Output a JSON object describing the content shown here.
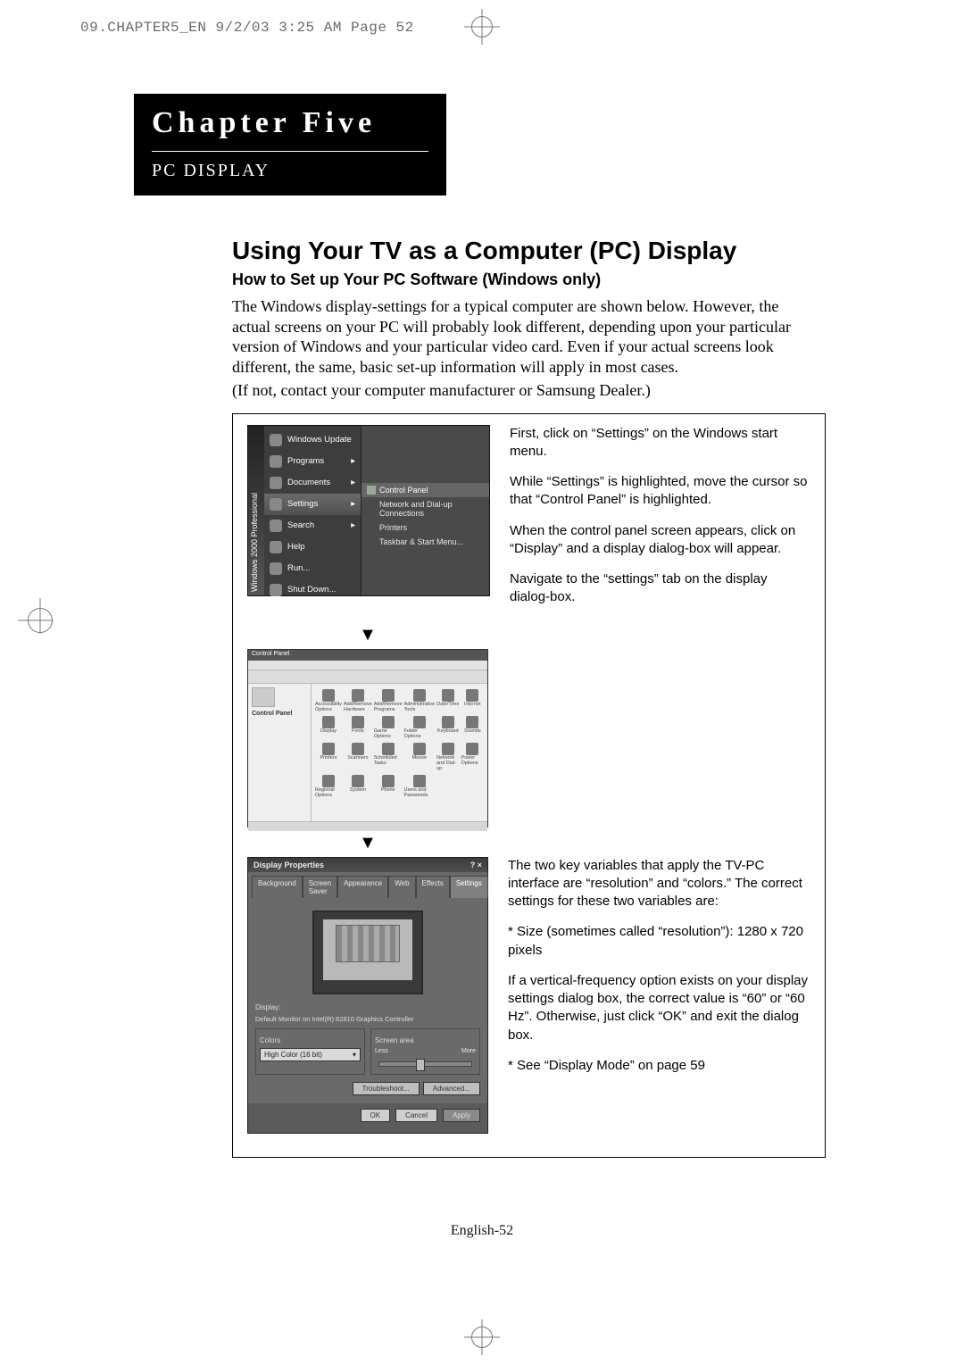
{
  "print_header": "09.CHAPTER5_EN  9/2/03 3:25 AM  Page 52",
  "chapter": {
    "title": "Chapter Five",
    "subtitle": "PC DISPLAY"
  },
  "headings": {
    "main": "Using Your TV as a Computer (PC) Display",
    "sub": "How to Set up Your PC Software (Windows only)"
  },
  "intro": {
    "p1": "The Windows display-settings for a typical computer are shown below. However, the actual screens on your PC will probably look different, depending upon your particular version of Windows and your particular video card. Even if your actual screens look different, the same, basic set-up information will apply in most cases.",
    "p2": "(If not, contact your computer manufacturer or Samsung Dealer.)"
  },
  "startmenu": {
    "sidebar": "Windows 2000 Professional",
    "items": [
      "Windows Update",
      "Programs",
      "Documents",
      "Settings",
      "Search",
      "Help",
      "Run...",
      "Shut Down..."
    ],
    "selected": "Settings",
    "submenu_title": "Control Panel",
    "submenu": [
      "Network and Dial-up Connections",
      "Printers",
      "Taskbar & Start Menu..."
    ]
  },
  "step1": {
    "p1": "First, click on “Settings” on the Windows start menu.",
    "p2": "While “Settings” is highlighted, move the cursor so that “Control Panel” is highlighted.",
    "p3": "When the control panel screen appears, click on “Display” and a display dialog-box will appear.",
    "p4": "Navigate to the “settings” tab on the display dialog-box."
  },
  "controlpanel": {
    "title": "Control Panel",
    "left_title": "Control Panel",
    "icons": [
      "Accessibility Options",
      "Add/Remove Hardware",
      "Add/Remove Programs",
      "Administrative Tools",
      "Date/Time",
      "Internet",
      "Display",
      "Fonts",
      "Game Options",
      "Folder Options",
      "Keyboard",
      "Sounds",
      "Printers",
      "Scanners",
      "Scheduled Tasks",
      "Mouse",
      "Network and Dial-up",
      "Power Options",
      "Regional Options",
      "System",
      "Phone",
      "Users and Passwords"
    ]
  },
  "displayprops": {
    "title": "Display Properties",
    "tabs": [
      "Background",
      "Screen Saver",
      "Appearance",
      "Web",
      "Effects",
      "Settings"
    ],
    "active_tab": "Settings",
    "display_label": "Display:",
    "display_value": "Default Monitor on Intel(R) 82810 Graphics Controller",
    "colors_group": "Colors",
    "colors_value": "High Color (16 bit)",
    "screen_area_group": "Screen area",
    "screen_area_less": "Less",
    "screen_area_more": "More",
    "btn_troubleshoot": "Troubleshoot...",
    "btn_advanced": "Advanced...",
    "btn_ok": "OK",
    "btn_cancel": "Cancel",
    "btn_apply": "Apply"
  },
  "step2": {
    "p1": "The two key variables that apply the TV-PC interface are “resolution” and “colors.” The correct settings for these two variables are:",
    "p2": "* Size (sometimes called “resolution”): 1280 x 720 pixels",
    "p3": "If a vertical-frequency option exists on your display settings dialog box, the correct value is “60” or “60 Hz”. Otherwise, just click “OK” and exit the dialog box.",
    "p4": "* See “Display Mode” on page 59"
  },
  "footer": "English-52"
}
